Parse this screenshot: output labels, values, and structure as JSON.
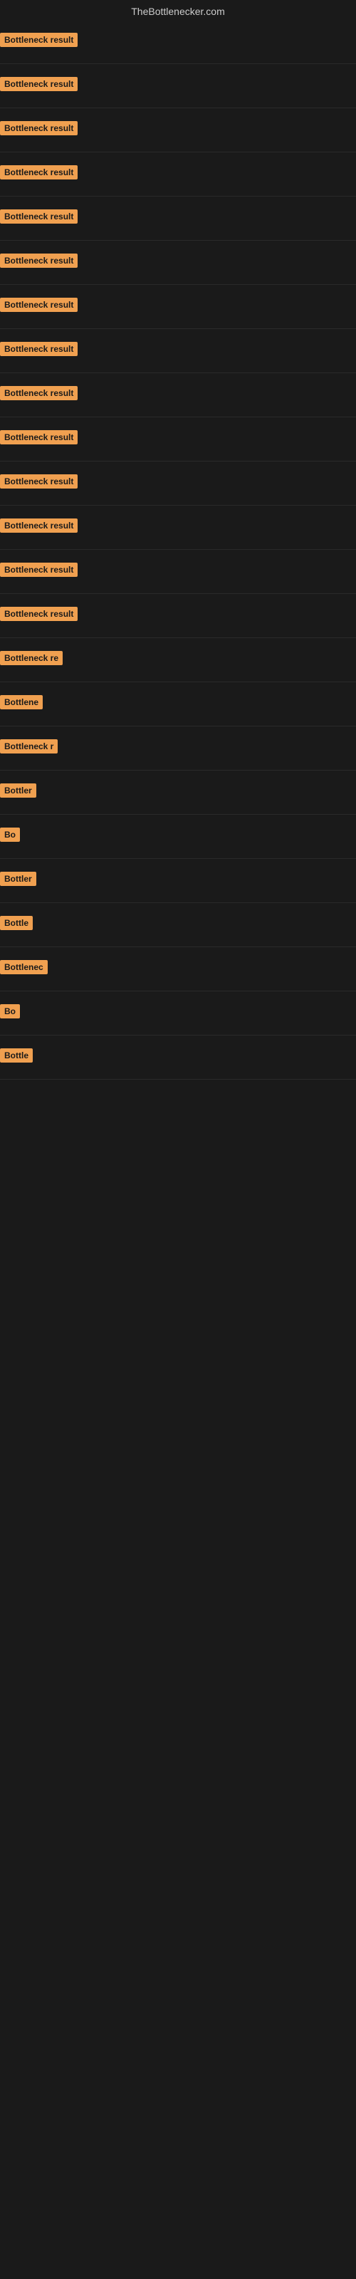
{
  "site": {
    "title": "TheBottlenecker.com"
  },
  "results": [
    {
      "id": 1,
      "label": "Bottleneck result",
      "width": 130
    },
    {
      "id": 2,
      "label": "Bottleneck result",
      "width": 130
    },
    {
      "id": 3,
      "label": "Bottleneck result",
      "width": 130
    },
    {
      "id": 4,
      "label": "Bottleneck result",
      "width": 130
    },
    {
      "id": 5,
      "label": "Bottleneck result",
      "width": 130
    },
    {
      "id": 6,
      "label": "Bottleneck result",
      "width": 130
    },
    {
      "id": 7,
      "label": "Bottleneck result",
      "width": 130
    },
    {
      "id": 8,
      "label": "Bottleneck result",
      "width": 130
    },
    {
      "id": 9,
      "label": "Bottleneck result",
      "width": 130
    },
    {
      "id": 10,
      "label": "Bottleneck result",
      "width": 130
    },
    {
      "id": 11,
      "label": "Bottleneck result",
      "width": 130
    },
    {
      "id": 12,
      "label": "Bottleneck result",
      "width": 130
    },
    {
      "id": 13,
      "label": "Bottleneck result",
      "width": 130
    },
    {
      "id": 14,
      "label": "Bottleneck result",
      "width": 115
    },
    {
      "id": 15,
      "label": "Bottleneck re",
      "width": 90
    },
    {
      "id": 16,
      "label": "Bottlene",
      "width": 70
    },
    {
      "id": 17,
      "label": "Bottleneck r",
      "width": 85
    },
    {
      "id": 18,
      "label": "Bottler",
      "width": 55
    },
    {
      "id": 19,
      "label": "Bo",
      "width": 28
    },
    {
      "id": 20,
      "label": "Bottler",
      "width": 55
    },
    {
      "id": 21,
      "label": "Bottle",
      "width": 48
    },
    {
      "id": 22,
      "label": "Bottlenec",
      "width": 72
    },
    {
      "id": 23,
      "label": "Bo",
      "width": 28
    },
    {
      "id": 24,
      "label": "Bottle",
      "width": 48
    }
  ]
}
